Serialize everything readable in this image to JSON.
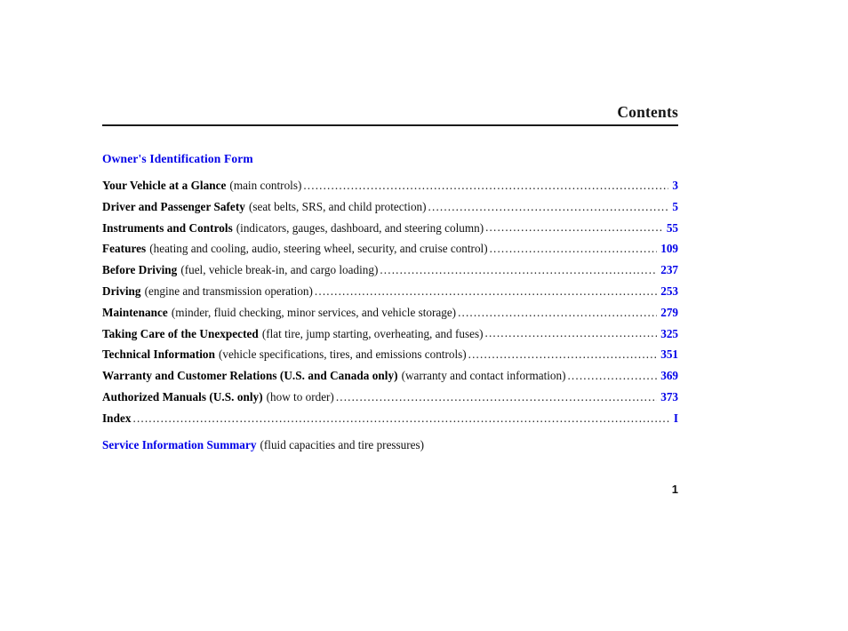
{
  "header": {
    "title": "Contents"
  },
  "toc": {
    "section_head": "Owner's Identification Form",
    "entries": [
      {
        "title": "Your Vehicle at a Glance",
        "desc": "(main controls)",
        "page": "3"
      },
      {
        "title": "Driver and Passenger Safety",
        "desc": "(seat belts, SRS, and child protection)",
        "page": "5"
      },
      {
        "title": "Instruments and Controls",
        "desc": "(indicators, gauges, dashboard, and steering column)",
        "page": "55"
      },
      {
        "title": "Features",
        "desc": "(heating and cooling, audio, steering wheel, security, and cruise control)",
        "page": "109"
      },
      {
        "title": "Before Driving",
        "desc": "(fuel, vehicle break-in, and cargo loading)",
        "page": "237"
      },
      {
        "title": "Driving",
        "desc": "(engine and transmission operation)",
        "page": "253"
      },
      {
        "title": "Maintenance",
        "desc": "(minder, fluid checking, minor services, and vehicle storage)",
        "page": "279"
      },
      {
        "title": "Taking Care of the Unexpected",
        "desc": "(flat tire, jump starting, overheating, and fuses)",
        "page": "325"
      },
      {
        "title": "Technical Information",
        "desc": "(vehicle specifications, tires, and emissions controls)",
        "page": "351"
      },
      {
        "title": "Warranty and Customer Relations (U.S. and Canada only)",
        "desc": "(warranty and contact information)",
        "page": "369"
      },
      {
        "title": "Authorized Manuals (U.S. only)",
        "desc": "(how to order)",
        "page": "373"
      },
      {
        "title": "Index",
        "desc": "",
        "page": "I"
      }
    ],
    "footer_entry": {
      "title": "Service Information Summary",
      "desc": "(fluid capacities and tire pressures)"
    }
  },
  "folio": {
    "page_number": "1"
  },
  "colors": {
    "link_blue": "#0000e8",
    "text_black": "#111111",
    "rule": "#1a1a1a"
  }
}
